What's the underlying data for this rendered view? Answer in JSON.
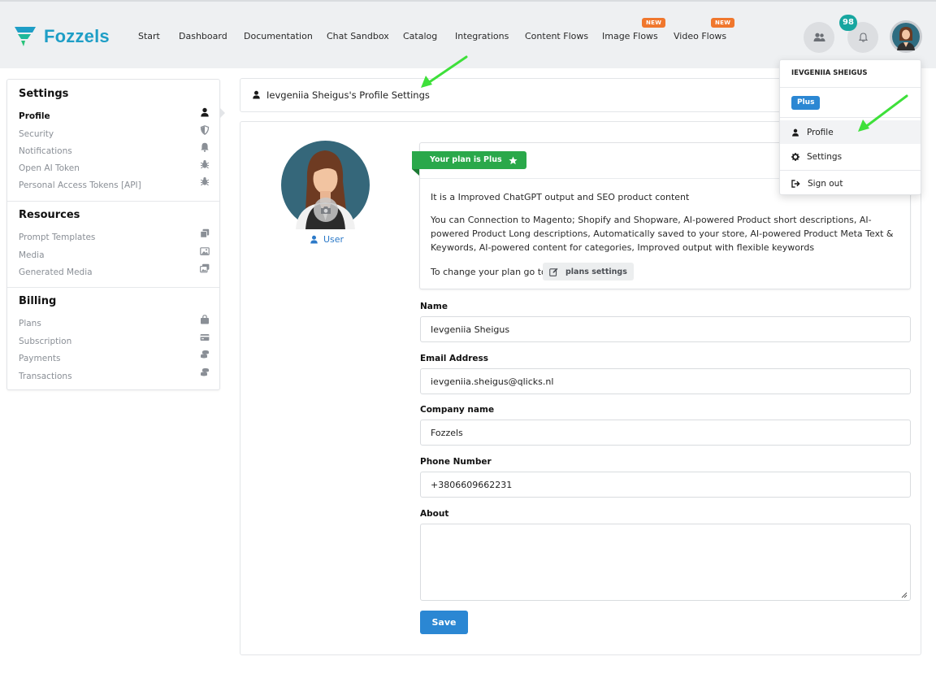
{
  "brand": {
    "name": "Fozzels",
    "color": "#1e9ec6"
  },
  "nav": {
    "items": [
      {
        "label": "Start"
      },
      {
        "label": "Dashboard"
      },
      {
        "label": "Documentation"
      },
      {
        "label": "Chat Sandbox"
      },
      {
        "label": "Catalog"
      },
      {
        "label": "Integrations"
      },
      {
        "label": "Content Flows"
      },
      {
        "label": "Image Flows",
        "badge": "NEW"
      },
      {
        "label": "Video Flows",
        "badge": "NEW"
      }
    ],
    "notification_count": "98"
  },
  "sidebar": {
    "sections": [
      {
        "title": "Settings",
        "items": [
          {
            "label": "Profile",
            "icon": "user-icon",
            "active": true
          },
          {
            "label": "Security",
            "icon": "shield-icon"
          },
          {
            "label": "Notifications",
            "icon": "bell-icon"
          },
          {
            "label": "Open AI Token",
            "icon": "bug-icon"
          },
          {
            "label": "Personal Access Tokens [API]",
            "icon": "bug-icon"
          }
        ]
      },
      {
        "title": "Resources",
        "items": [
          {
            "label": "Prompt Templates",
            "icon": "copy-icon"
          },
          {
            "label": "Media",
            "icon": "image-icon"
          },
          {
            "label": "Generated Media",
            "icon": "images-icon"
          }
        ]
      },
      {
        "title": "Billing",
        "items": [
          {
            "label": "Plans",
            "icon": "bag-icon"
          },
          {
            "label": "Subscription",
            "icon": "card-icon"
          },
          {
            "label": "Payments",
            "icon": "coins-icon"
          },
          {
            "label": "Transactions",
            "icon": "coins-icon"
          }
        ]
      }
    ]
  },
  "page": {
    "heading": "Ievgeniia Sheigus's Profile Settings"
  },
  "profile": {
    "role": "User"
  },
  "plan": {
    "ribbon": "Your plan is Plus",
    "description": "It is a Improved ChatGPT output and SEO product content",
    "features": "You can Connection to Magento; Shopify and Shopware, AI-powered Product short descriptions, AI-powered Product Long descriptions, Automatically saved to your store, AI-powered Product Meta Text & Keywords, AI-powered content for categories, Improved output with flexible keywords",
    "change_text": "To change your plan go to",
    "settings_link": "plans settings",
    "accent_color": "#2aa84a"
  },
  "form": {
    "name_label": "Name",
    "name_value": "Ievgeniia Sheigus",
    "email_label": "Email Address",
    "email_value": "ievgeniia.sheigus@qlicks.nl",
    "company_label": "Company name",
    "company_value": "Fozzels",
    "phone_label": "Phone Number",
    "phone_value": "+3806609662231",
    "about_label": "About",
    "about_value": "",
    "save_label": "Save",
    "button_color": "#2b87d3"
  },
  "user_menu": {
    "name": "IEVGENIIA SHEIGUS",
    "plan_badge": "Plus",
    "items": [
      {
        "label": "Profile",
        "icon": "user-icon"
      },
      {
        "label": "Settings",
        "icon": "gear-icon"
      },
      {
        "label": "Sign out",
        "icon": "sign-out-icon"
      }
    ]
  },
  "annotations": {
    "arrow_color": "#3ee03a"
  }
}
